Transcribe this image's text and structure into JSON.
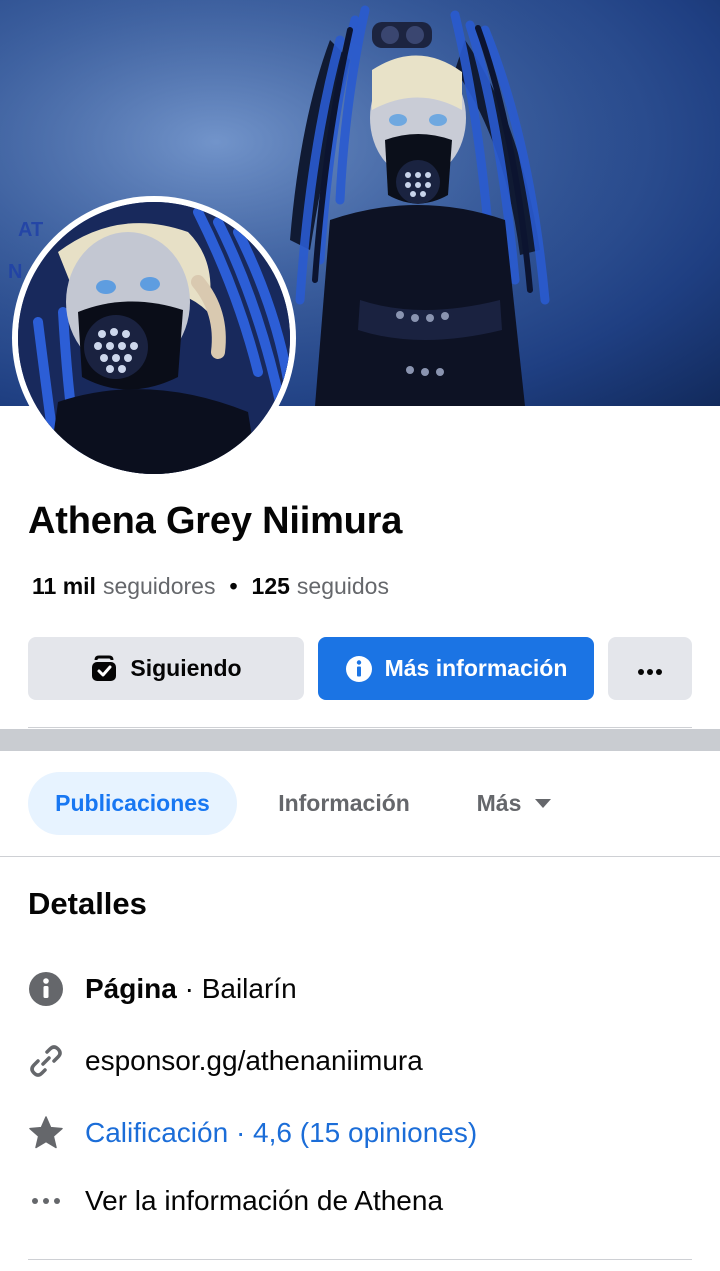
{
  "profile": {
    "name": "Athena Grey Niimura",
    "followers_count": "11 mil",
    "followers_label": "seguidores",
    "separator": "•",
    "following_count": "125",
    "following_label": "seguidos"
  },
  "actions": {
    "following_label": "Siguiendo",
    "more_info_label": "Más información",
    "more_icon": "ellipsis-icon",
    "accent": "#1b74e4"
  },
  "tabs": [
    {
      "label": "Publicaciones",
      "active": true
    },
    {
      "label": "Información",
      "active": false
    },
    {
      "label": "Más",
      "active": false
    }
  ],
  "details": {
    "title": "Detalles",
    "page_label": "Página",
    "page_separator": " · ",
    "page_category": "Bailarín",
    "link": "esponsor.gg/athenaniimura",
    "rating": "Calificación · 4,6 (15 opiniones)",
    "see_info": "Ver la información de Athena",
    "rating_color": "#1b6dd8"
  },
  "icons": {
    "info": "info-circle-icon",
    "link": "link-icon",
    "star": "star-icon",
    "more": "ellipsis-icon",
    "following": "followed-check-icon"
  }
}
